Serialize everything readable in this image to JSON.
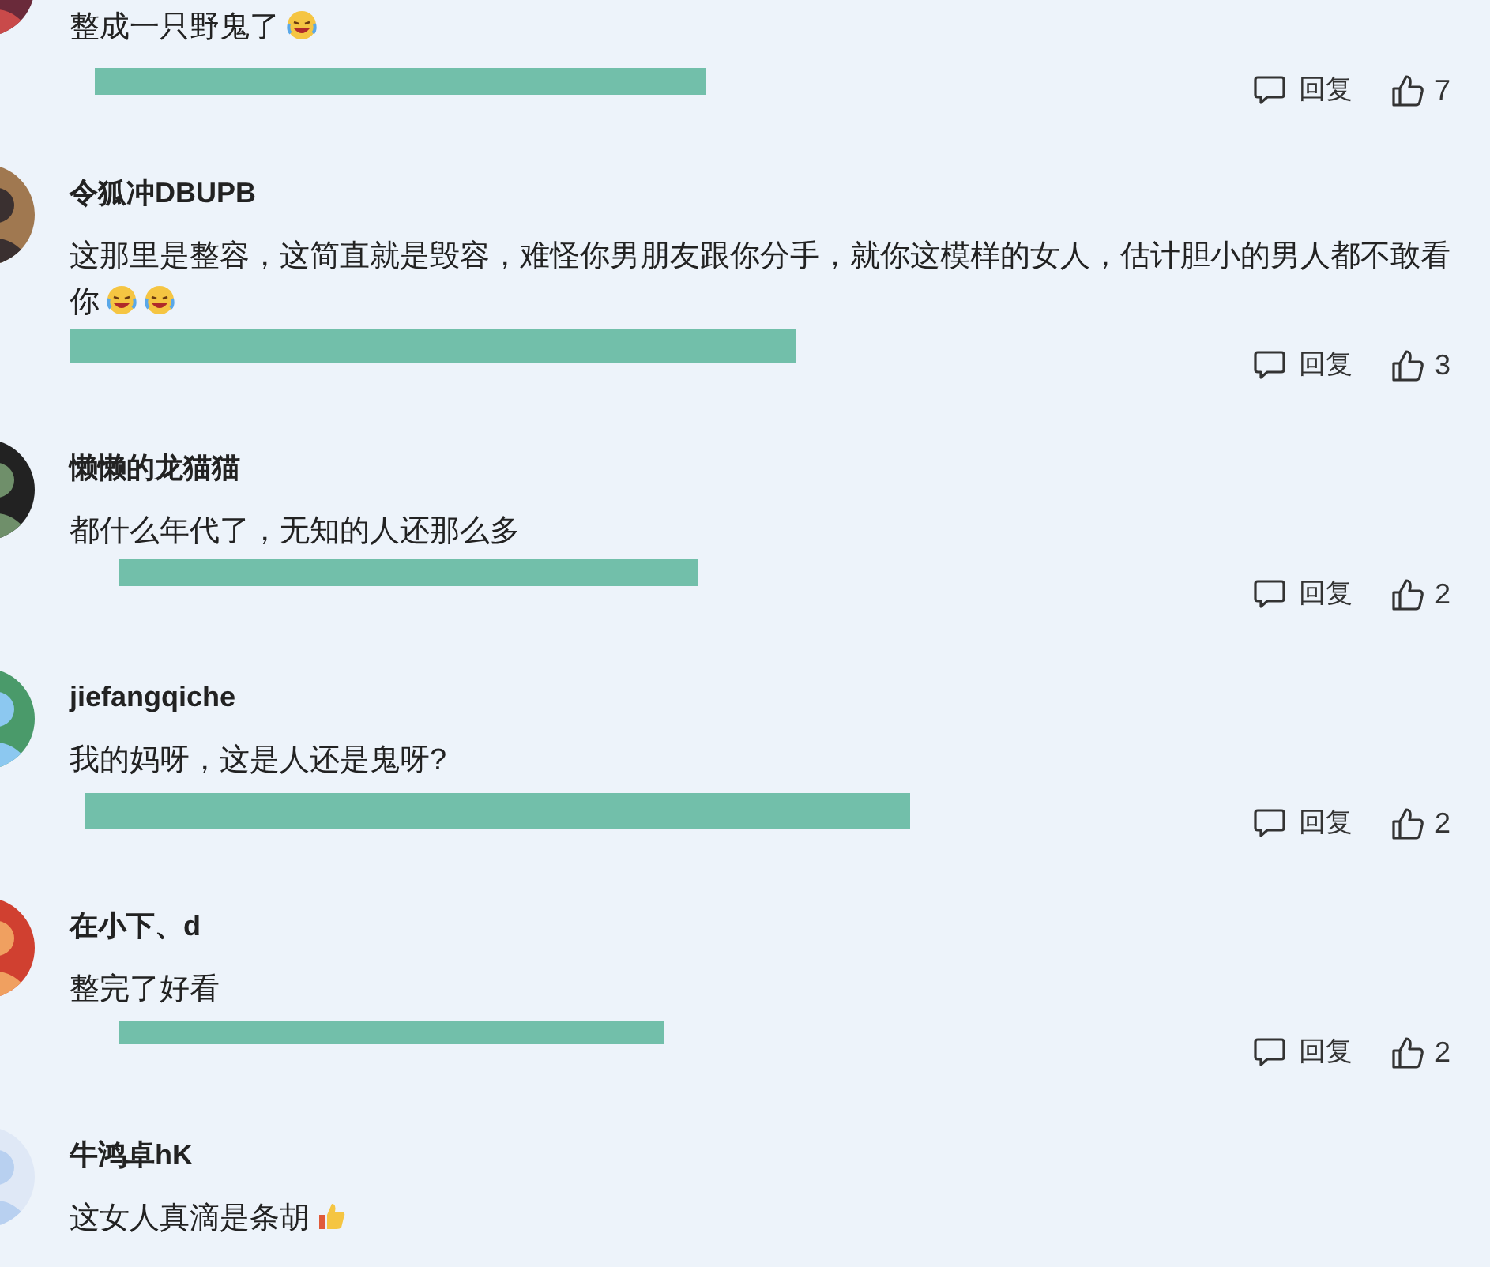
{
  "comments": [
    {
      "text": "整成一只野鬼了",
      "emojis": [
        {
          "kind": "cry-laugh"
        }
      ],
      "redacted": true,
      "reply": "回复",
      "likes": "7"
    },
    {
      "name": "令狐冲DBUPB",
      "text": "这那里是整容，这简直就是毁容，难怪你男朋友跟你分手，就你这模样的女人，估计胆小的男人都不敢看你",
      "emojis": [
        {
          "kind": "cry-laugh"
        },
        {
          "kind": "cry-laugh"
        }
      ],
      "redacted": true,
      "reply": "回复",
      "likes": "3"
    },
    {
      "name": "懒懒的龙猫猫",
      "text": "都什么年代了，无知的人还那么多",
      "redacted": true,
      "reply": "回复",
      "likes": "2"
    },
    {
      "name": "jiefangqiche",
      "text": "我的妈呀，这是人还是鬼呀?",
      "redacted": true,
      "reply": "回复",
      "likes": "2"
    },
    {
      "name": "在小下、d",
      "text": "整完了好看",
      "redacted": true,
      "reply": "回复",
      "likes": "2"
    },
    {
      "name": "牛鸿卓hK",
      "text": "这女人真滴是条胡",
      "emojis": [
        {
          "kind": "thumbs-up"
        }
      ]
    }
  ]
}
